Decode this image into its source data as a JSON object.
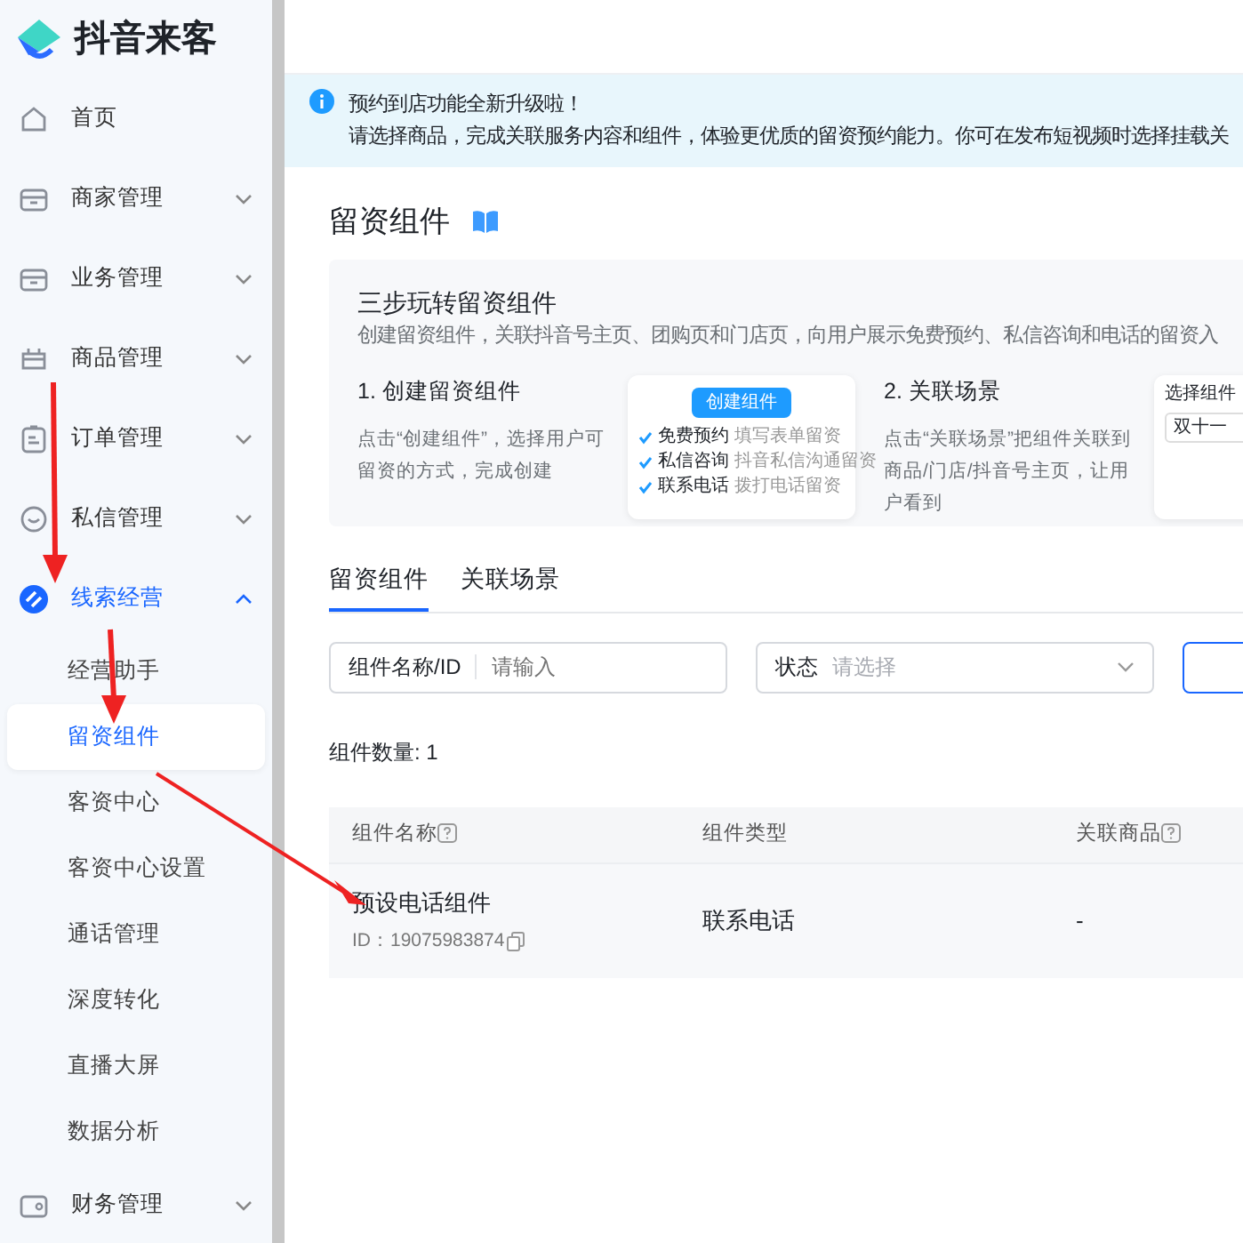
{
  "logo": {
    "text": "抖音来客"
  },
  "sidebar": {
    "items": [
      {
        "label": "首页",
        "selected": false
      },
      {
        "label": "商家管理",
        "selected": false,
        "expanded": false
      },
      {
        "label": "业务管理",
        "selected": false,
        "expanded": false
      },
      {
        "label": "商品管理",
        "selected": false,
        "expanded": false
      },
      {
        "label": "订单管理",
        "selected": false,
        "expanded": false
      },
      {
        "label": "私信管理",
        "selected": false,
        "expanded": false
      },
      {
        "label": "线索经营",
        "selected": true,
        "expanded": true,
        "children": [
          {
            "label": "经营助手",
            "selected": false
          },
          {
            "label": "留资组件",
            "selected": true
          },
          {
            "label": "客资中心",
            "selected": false
          },
          {
            "label": "客资中心设置",
            "selected": false
          },
          {
            "label": "通话管理",
            "selected": false
          },
          {
            "label": "深度转化",
            "selected": false
          },
          {
            "label": "直播大屏",
            "selected": false
          },
          {
            "label": "数据分析",
            "selected": false
          }
        ]
      },
      {
        "label": "财务管理",
        "selected": false,
        "expanded": false
      }
    ]
  },
  "notice": {
    "title": "预约到店功能全新升级啦！",
    "text": "请选择商品，完成关联服务内容和组件，体验更优质的留资预约能力。你可在发布短视频时选择挂载关"
  },
  "page_title": "留资组件",
  "guide": {
    "title": "三步玩转留资组件",
    "subtitle": "创建留资组件，关联抖音号主页、团购页和门店页，向用户展示免费预约、私信咨询和电话的留资入",
    "steps": [
      {
        "title": "1. 创建留资组件",
        "text": "点击“创建组件”，选择用户可留资的方式，完成创建",
        "illustration": {
          "kind": "options",
          "button": "创建组件",
          "options": [
            {
              "label": "免费预约",
              "hint": "填写表单留资"
            },
            {
              "label": "私信咨询",
              "hint": "抖音私信沟通留资"
            },
            {
              "label": "联系电话",
              "hint": "拨打电话留资"
            }
          ]
        }
      },
      {
        "title": "2. 关联场景",
        "text": "点击“关联场景”把组件关联到商品/门店/抖音号主页，让用户看到",
        "illustration": {
          "kind": "select",
          "label": "选择组件",
          "value": "双十一"
        }
      }
    ]
  },
  "tabs": [
    {
      "label": "留资组件",
      "selected": true
    },
    {
      "label": "关联场景",
      "selected": false
    }
  ],
  "filters": {
    "name": {
      "label": "组件名称/ID",
      "placeholder": "请输入"
    },
    "status": {
      "label": "状态",
      "placeholder": "请选择"
    }
  },
  "count": "组件数量: 1",
  "table": {
    "columns": [
      {
        "label": "组件名称",
        "help": true
      },
      {
        "label": "组件类型",
        "help": false
      },
      {
        "label": "关联商品",
        "help": true
      }
    ],
    "rows": [
      {
        "name": "预设电话组件",
        "id": "ID：19075983874",
        "type": "联系电话",
        "products": "-"
      }
    ]
  }
}
